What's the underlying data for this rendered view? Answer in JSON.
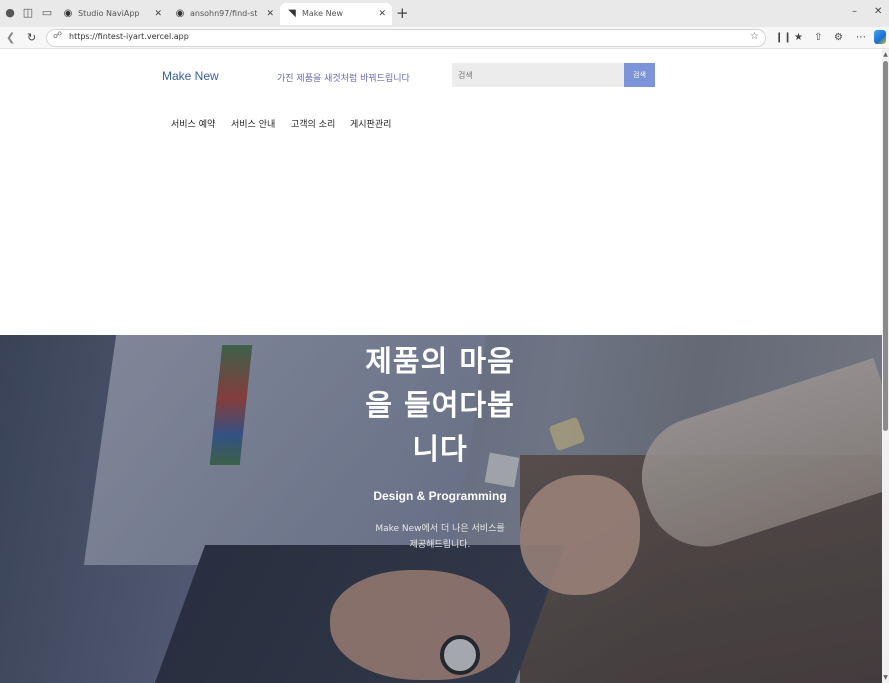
{
  "browser": {
    "tabs": [
      {
        "title": "Studio NaviApp",
        "active": false
      },
      {
        "title": "ansohn97/find-st",
        "active": false
      },
      {
        "title": "Make New",
        "active": true
      }
    ],
    "url": "https://fintest-iyart.vercel.app"
  },
  "site": {
    "logo": "Make New",
    "slogan": "가진 제품을 새것처럼 바꿔드립니다",
    "search": {
      "placeholder": "검색",
      "button": "검색"
    },
    "menu": [
      "서비스 예약",
      "서비스 안내",
      "고객의 소리",
      "게시판관리"
    ]
  },
  "hero": {
    "title_lines": [
      "제품의 마음",
      "을 들여다봅",
      "니다"
    ],
    "subtitle": "Design & Programming",
    "desc_lines": [
      "Make New에서 더 나은 서비스를",
      "제공해드립니다."
    ]
  }
}
